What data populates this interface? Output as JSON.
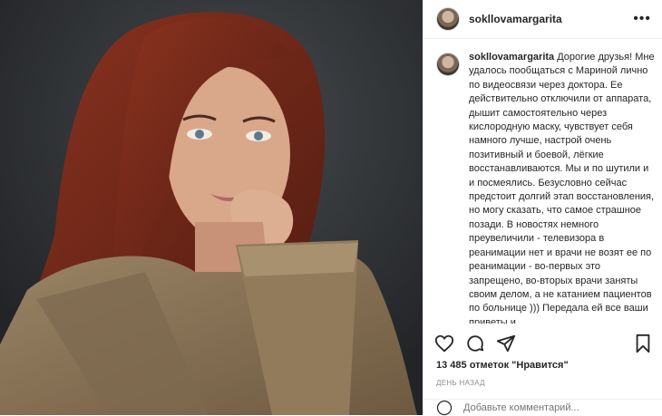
{
  "post": {
    "username": "sokllovamargarita",
    "more_icon": "more-horizontal-icon",
    "caption_text": "Дорогие друзья! Мне удалось пообщаться с Мариной лично по видеосвязи через доктора. Ее действительно отключили от аппарата, дышит самостоятельно через кислородную маску, чувствует себя намного лучше, настрой очень позитивный и боевой, лёгкие восстанавливаются. Мы и по шутили и и посмеялись. Безусловно сейчас предстоит долгий этап восстановления, но могу сказать, что самое страшное позади. В новостях немного преувеличили - телевизора в реанимации нет и врачи не возят ее по реанимации - во-первых это запрещено, во-вторых врачи заняты своим делом, а не катанием пациентов по больнице ))) Передала ей все ваши приветы и",
    "likes": "13 485 отметок \"Нравится\"",
    "date": "День назад",
    "comment_placeholder": "Добавьте комментарий..."
  },
  "icons": {
    "like": "heart-icon",
    "comment": "comment-icon",
    "share": "share-icon",
    "save": "bookmark-icon"
  },
  "colors": {
    "text": "#262626",
    "muted": "#8e8e8e",
    "border": "#efefef",
    "coat": "#8a7457",
    "hair": "#7a2a17"
  }
}
